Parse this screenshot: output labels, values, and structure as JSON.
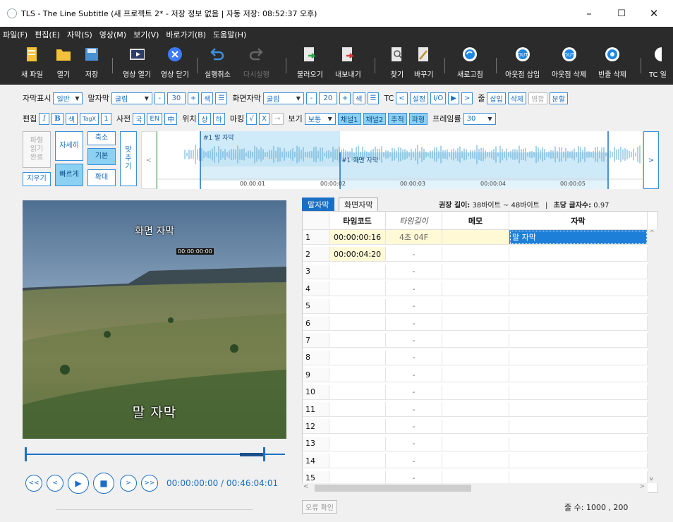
{
  "window": {
    "title": "TLS - The Line Subtitle (새 프로젝트 2* - 저장 정보 없음 | 자동 저장: 08:52:37 오후)",
    "controls": [
      "–",
      "☐",
      "✕"
    ]
  },
  "menu": [
    "파일(F)",
    "편집(E)",
    "자막(S)",
    "영상(M)",
    "보기(V)",
    "바로가기(B)",
    "도움말(H)"
  ],
  "toolbar": {
    "new_file": "새 파일",
    "open": "열기",
    "save": "저장",
    "video_open": "영상 열기",
    "video_close": "영상 닫기",
    "undo": "실행취소",
    "redo": "다시실행",
    "import": "불러오기",
    "export": "내보내기",
    "find": "찾기",
    "replace": "바꾸기",
    "refresh": "새로고침",
    "insert_out": "아웃점 삽입",
    "delete_out": "아웃점 삭제",
    "delete_blank": "빈줄 삭제",
    "tc_cut": "TC 일"
  },
  "row1": {
    "subtitle_display_label": "자막표시",
    "subtitle_display_value": "일반",
    "speech_label": "말자막",
    "speech_font": "굴림",
    "minus": "-",
    "speech_size": "30",
    "plus": "+",
    "color": "색",
    "align": "☰",
    "screen_label": "화면자막",
    "screen_font": "굴림",
    "screen_size": "20",
    "tc_label": "TC",
    "tc_prev": "<",
    "tc_set": "설정",
    "tc_io": "I/O",
    "tc_play": "▶",
    "tc_next": ">",
    "line_label": "줄",
    "insert": "삽입",
    "delete": "삭제",
    "merge": "병합",
    "split": "분할"
  },
  "row2": {
    "edit_label": "편집",
    "italic": "I",
    "bold": "B",
    "color": "색",
    "tagx": "TagX",
    "one": "1",
    "dict_label": "사전",
    "dict_ko": "국",
    "dict_en": "EN",
    "dict_cn": "中",
    "pos_label": "위치",
    "pos_top": "상",
    "pos_bottom": "하",
    "marking_label": "마킹",
    "mark_ok": "√",
    "mark_x": "X",
    "arrow": "→",
    "view_label": "보기",
    "view_value": "보통",
    "ch1": "채널1",
    "ch2": "채널2",
    "track": "추적",
    "waveform": "파형",
    "framerate_label": "프레임률",
    "framerate_value": "30"
  },
  "wave_panel": {
    "waveform_done": "파형\n읽기\n완료",
    "detail": "자세히",
    "zoom_out": "축소",
    "basic": "기본",
    "zoom_in": "확대",
    "erase": "지우기",
    "fast": "빠르게",
    "fit": "맞\n추\n기",
    "scroll_left": "<",
    "scroll_right": ">",
    "marker1": "#1 말 자막",
    "marker2": "#1 화면 자막",
    "times": [
      "00:00:01",
      "00:00:02",
      "00:00:03",
      "00:00:04",
      "00:00:05"
    ]
  },
  "video": {
    "screen_caption": "화면 자막",
    "timecode_overlay": "00:00:00:00",
    "speech_caption": "말 자막"
  },
  "player": {
    "buttons": [
      "<<",
      "<",
      "▶",
      "■",
      ">",
      ">>"
    ],
    "time": "00:00:00:00 / 00:46:04:01",
    "progress": 0.0
  },
  "tabs": {
    "speech": "말자막",
    "screen": "화면자막",
    "rec_label": "권장 길이:",
    "rec_value": "38바이트 ~ 48바이트",
    "sep": "|",
    "cps_label": "초당 글자수:",
    "cps_value": "0.97"
  },
  "grid": {
    "headers": [
      "",
      "타임코드",
      "타임길이",
      "메모",
      "자막"
    ],
    "rows": [
      {
        "n": "1",
        "tc": "00:00:00:16",
        "len": "4초 04F",
        "memo": "",
        "text": "말 자막"
      },
      {
        "n": "2",
        "tc": "00:00:04:20",
        "len": "-",
        "memo": "",
        "text": ""
      },
      {
        "n": "3",
        "tc": "",
        "len": "-",
        "memo": "",
        "text": ""
      },
      {
        "n": "4",
        "tc": "",
        "len": "-",
        "memo": "",
        "text": ""
      },
      {
        "n": "5",
        "tc": "",
        "len": "-",
        "memo": "",
        "text": ""
      },
      {
        "n": "6",
        "tc": "",
        "len": "-",
        "memo": "",
        "text": ""
      },
      {
        "n": "7",
        "tc": "",
        "len": "-",
        "memo": "",
        "text": ""
      },
      {
        "n": "8",
        "tc": "",
        "len": "-",
        "memo": "",
        "text": ""
      },
      {
        "n": "9",
        "tc": "",
        "len": "-",
        "memo": "",
        "text": ""
      },
      {
        "n": "10",
        "tc": "",
        "len": "-",
        "memo": "",
        "text": ""
      },
      {
        "n": "11",
        "tc": "",
        "len": "-",
        "memo": "",
        "text": ""
      },
      {
        "n": "12",
        "tc": "",
        "len": "-",
        "memo": "",
        "text": ""
      },
      {
        "n": "13",
        "tc": "",
        "len": "-",
        "memo": "",
        "text": ""
      },
      {
        "n": "14",
        "tc": "",
        "len": "-",
        "memo": "",
        "text": ""
      },
      {
        "n": "15",
        "tc": "",
        "len": "-",
        "memo": "",
        "text": ""
      }
    ]
  },
  "status": {
    "error_check": "오류 확인",
    "line_count_label": "줄 수:",
    "line_count_value": "1000 ,  200"
  },
  "colors": {
    "accent": "#1a6fc4",
    "toggle_on": "#8cd0f2",
    "dark_bar": "#2b2b2b",
    "selected_cell": "#1e7fd8",
    "timecode_cell": "#fff9d6"
  }
}
